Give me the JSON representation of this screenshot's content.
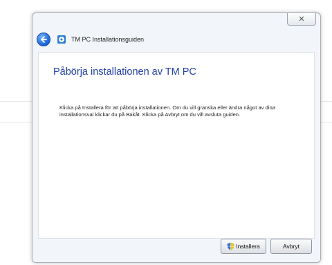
{
  "window": {
    "title": "TM PC Installationsguiden",
    "close_glyph": "✕"
  },
  "content": {
    "heading": "Påbörja installationen av TM PC",
    "description": "Klicka på Installera för att påbörja installationen. Om du vill granska eller ändra något av dina installationsval klickar du på Bakåt. Klicka på Avbryt om du vill avsluta guiden."
  },
  "buttons": {
    "install": "Installera",
    "cancel": "Avbryt"
  },
  "icons": {
    "back": "back-arrow-icon",
    "app": "setup-disc-icon",
    "install": "uac-shield-icon"
  },
  "colors": {
    "heading": "#1f3fa6",
    "back_button": "#1c63d6"
  }
}
